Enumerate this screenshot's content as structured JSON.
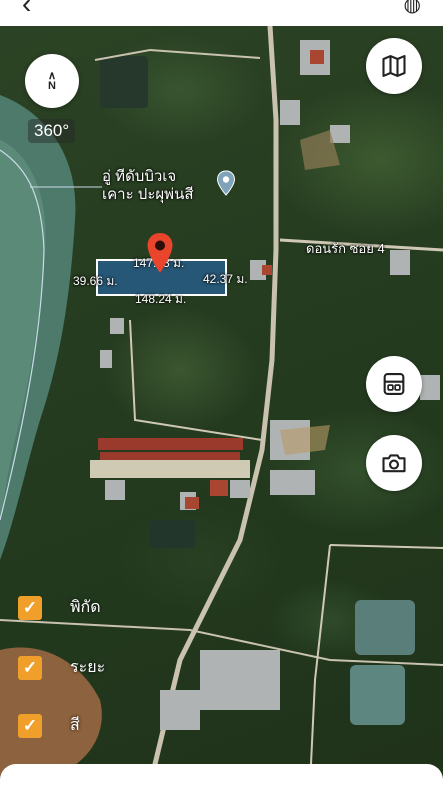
{
  "map": {
    "compass_north": "N",
    "rotation_label": "360°",
    "poi_name_line1": "อู่ ทีดับบิวเจ",
    "poi_name_line2": "เคาะ ปะผุพ่นสี",
    "road_name": "ดอนรัก ซอย 4"
  },
  "plot": {
    "top_length": "147.43 ม.",
    "left_length": "39.66 ม.",
    "right_length": "42.37 ม.",
    "bottom_length": "148.24 ม."
  },
  "layers": [
    {
      "label": "พิกัด",
      "checked": true
    },
    {
      "label": "ระยะ",
      "checked": true
    },
    {
      "label": "สี",
      "checked": true
    }
  ],
  "icons": {
    "map_type": "map-icon",
    "save": "save-icon",
    "camera": "camera-icon",
    "compass": "compass-icon"
  },
  "colors": {
    "accent_checkbox": "#f0a02a",
    "pin_red": "#e8452c",
    "plot_fill": "#2e6ebe"
  }
}
